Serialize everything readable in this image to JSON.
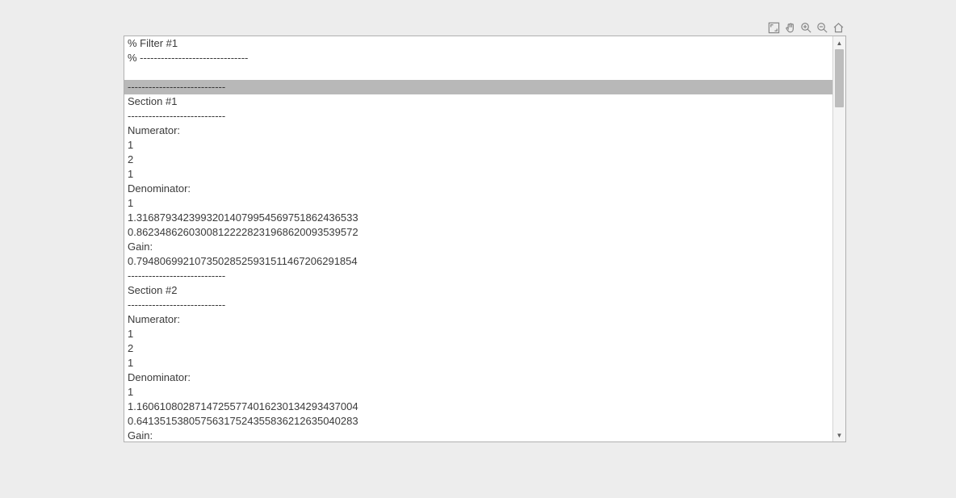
{
  "toolbar": {
    "icons": [
      "expand",
      "pan",
      "zoom-in",
      "zoom-out",
      "home"
    ]
  },
  "lines": [
    {
      "text": "% Filter #1",
      "highlight": false
    },
    {
      "text": "% -------------------------------",
      "highlight": false
    },
    {
      "text": "",
      "highlight": false
    },
    {
      "text": "----------------------------",
      "highlight": true
    },
    {
      "text": "Section #1",
      "highlight": false
    },
    {
      "text": "----------------------------",
      "highlight": false
    },
    {
      "text": "Numerator:",
      "highlight": false
    },
    {
      "text": "1",
      "highlight": false
    },
    {
      "text": "2",
      "highlight": false
    },
    {
      "text": "1",
      "highlight": false
    },
    {
      "text": "Denominator:",
      "highlight": false
    },
    {
      "text": "1",
      "highlight": false
    },
    {
      "text": "1.31687934239932014079954569751862436533",
      "highlight": false
    },
    {
      "text": "0.86234862603008122228231968620093539572",
      "highlight": false
    },
    {
      "text": "Gain:",
      "highlight": false
    },
    {
      "text": "0.79480699210735028525931511467206291854",
      "highlight": false
    },
    {
      "text": "----------------------------",
      "highlight": false
    },
    {
      "text": "Section #2",
      "highlight": false
    },
    {
      "text": "----------------------------",
      "highlight": false
    },
    {
      "text": "Numerator:",
      "highlight": false
    },
    {
      "text": "1",
      "highlight": false
    },
    {
      "text": "2",
      "highlight": false
    },
    {
      "text": "1",
      "highlight": false
    },
    {
      "text": "Denominator:",
      "highlight": false
    },
    {
      "text": "1",
      "highlight": false
    },
    {
      "text": "1.16061080287147255774016230134293437004",
      "highlight": false
    },
    {
      "text": "0.64135153805756317524355836212635040283",
      "highlight": false
    },
    {
      "text": "Gain:",
      "highlight": false
    }
  ]
}
